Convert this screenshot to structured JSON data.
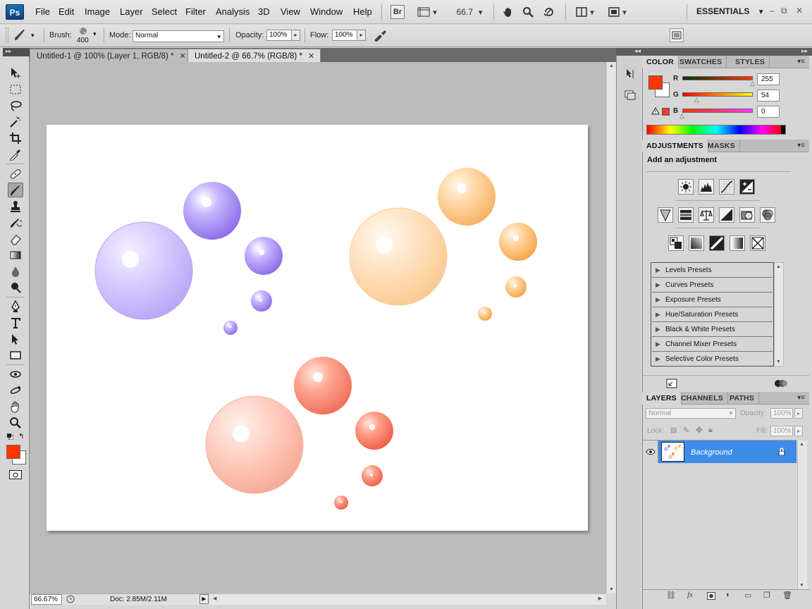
{
  "app": {
    "logo": "Ps",
    "menu": [
      "File",
      "Edit",
      "Image",
      "Layer",
      "Select",
      "Filter",
      "Analysis",
      "3D",
      "View",
      "Window",
      "Help"
    ],
    "bridge_label": "Br",
    "zoom_level": "66.7",
    "workspace": "ESSENTIALS",
    "window_controls": [
      "–",
      "⧉",
      "✕"
    ]
  },
  "options": {
    "brush_label": "Brush:",
    "brush_size": "400",
    "mode_label": "Mode:",
    "mode_value": "Normal",
    "opacity_label": "Opacity:",
    "opacity_value": "100%",
    "flow_label": "Flow:",
    "flow_value": "100%"
  },
  "documents": {
    "tabs": [
      {
        "label": "Untitled-1 @ 100% (Layer 1, RGB/8) *",
        "active": false
      },
      {
        "label": "Untitled-2 @ 66.7% (RGB/8) *",
        "active": true
      }
    ],
    "zoom_field": "66.67%",
    "doc_info": "Doc: 2.85M/2.11M"
  },
  "colors": {
    "foreground": "#ff3600",
    "background": "#ffffff",
    "accent_layer": "#3d8ce8"
  },
  "color_panel": {
    "tabs": [
      "COLOR",
      "SWATCHES",
      "STYLES"
    ],
    "r_label": "R",
    "r_value": "255",
    "g_label": "G",
    "g_value": "54",
    "b_label": "B",
    "b_value": "0"
  },
  "adjustments_panel": {
    "tabs": [
      "ADJUSTMENTS",
      "MASKS"
    ],
    "heading": "Add an adjustment",
    "presets": [
      "Levels Presets",
      "Curves Presets",
      "Exposure Presets",
      "Hue/Saturation Presets",
      "Black & White Presets",
      "Channel Mixer Presets",
      "Selective Color Presets"
    ]
  },
  "layers_panel": {
    "tabs": [
      "LAYERS",
      "CHANNELS",
      "PATHS"
    ],
    "blend_mode": "Normal",
    "opacity_label": "Opacity:",
    "opacity_value": "100%",
    "lock_label": "Lock:",
    "fill_label": "Fill:",
    "fill_value": "100%",
    "layer_name": "Background"
  },
  "tools": [
    "move",
    "marquee",
    "lasso",
    "magic-wand",
    "crop",
    "eyedropper",
    "healing",
    "brush",
    "stamp",
    "history-brush",
    "eraser",
    "gradient",
    "blur",
    "dodge",
    "pen",
    "type",
    "path-select",
    "shape",
    "3d-rotate",
    "3d-orbit",
    "hand",
    "zoom"
  ]
}
